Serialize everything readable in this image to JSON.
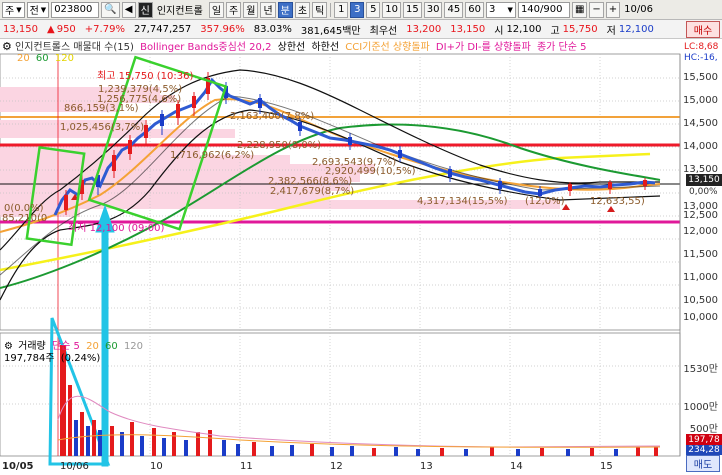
{
  "toolbar": {
    "market": "주",
    "market_opt": "전",
    "code": "023800",
    "name": "인지컨트롤",
    "periods": [
      "일",
      "주",
      "월",
      "년",
      "분",
      "초",
      "틱"
    ],
    "active_period": "분",
    "intervals": [
      "1",
      "3",
      "5",
      "10",
      "15",
      "30",
      "45",
      "60"
    ],
    "active_interval": "3",
    "interval_value": "3",
    "count": "140/900",
    "date": "10/06"
  },
  "infobar": {
    "price": "13,150",
    "change_arrow": "▲",
    "change": "950",
    "change_pct": "+7.79%",
    "volume": "27,747,257",
    "vol_ratio": "357.96%",
    "turnover": "83.03%",
    "amount": "381,645백만",
    "priority_label": "최우선",
    "ask": "13,200",
    "bid": "13,150",
    "open_label": "시",
    "open": "12,100",
    "high_label": "고",
    "high": "15,750",
    "low_label": "저",
    "low": "12,100",
    "buy_label": "매수",
    "sell_label": "매도"
  },
  "legend": {
    "item1": "인지컨트롤스 매물대 수(15)",
    "item2": "Bollinger Bands중심선 20,2",
    "item3": "상한선",
    "item4": "하한선",
    "item5": "CCI기준선 상향돌파",
    "item6": "DI+가 DI-를 상향돌파",
    "item7": "종가 단순 5",
    "lc": "LC:8,68",
    "hc": "HC:-16,",
    "ma20": "20",
    "ma60": "60",
    "ma120": "120",
    "gear": "⚙"
  },
  "annotations": {
    "high": "최고 15,750 (10:36)",
    "low_mark": "최저 12,100 (09:00)",
    "start": "0(0.0%)",
    "start2": "85,210(0",
    "a1": "1,239,379(4,5%)",
    "a2": "1,256,775(4,6%)",
    "a3": "866,159(3,1%)",
    "a4": "1,025,456(3,7%)",
    "a5": "2,163,400(7,8%)",
    "a6": "1,716,962(6,2%)",
    "a7": "2,228,950(8,0%)",
    "a8": "2,693,543(9,7%)",
    "a9": "2,920,499(10,5%)",
    "a10": "2,382,566(8,6%)",
    "a11": "2,417,679(8,7%)",
    "a12": "4,317,134(15,5%)",
    "a13": "(12,0%)",
    "a14": "12,633,55)"
  },
  "yaxis": [
    "15,500",
    "15,000",
    "14,500",
    "14,000",
    "13,500",
    "13,000",
    "12,500",
    "12,000",
    "11,500",
    "11,000",
    "10,500",
    "10,000"
  ],
  "price_tag": "13,150",
  "pct_tag": "0,00%",
  "volume_panel": {
    "legend_label": "거래량",
    "ma_label": "단순 5",
    "ma20": "20",
    "ma60": "60",
    "ma120": "120",
    "value": "197,784주",
    "value_pct": "(0.24%)",
    "axis": [
      "1530만",
      "1000만",
      "500만"
    ],
    "tag1": "197,78",
    "tag2": "234,28"
  },
  "dates": [
    "10/05",
    "10/06",
    "10",
    "11",
    "12",
    "13",
    "14",
    "15"
  ]
}
